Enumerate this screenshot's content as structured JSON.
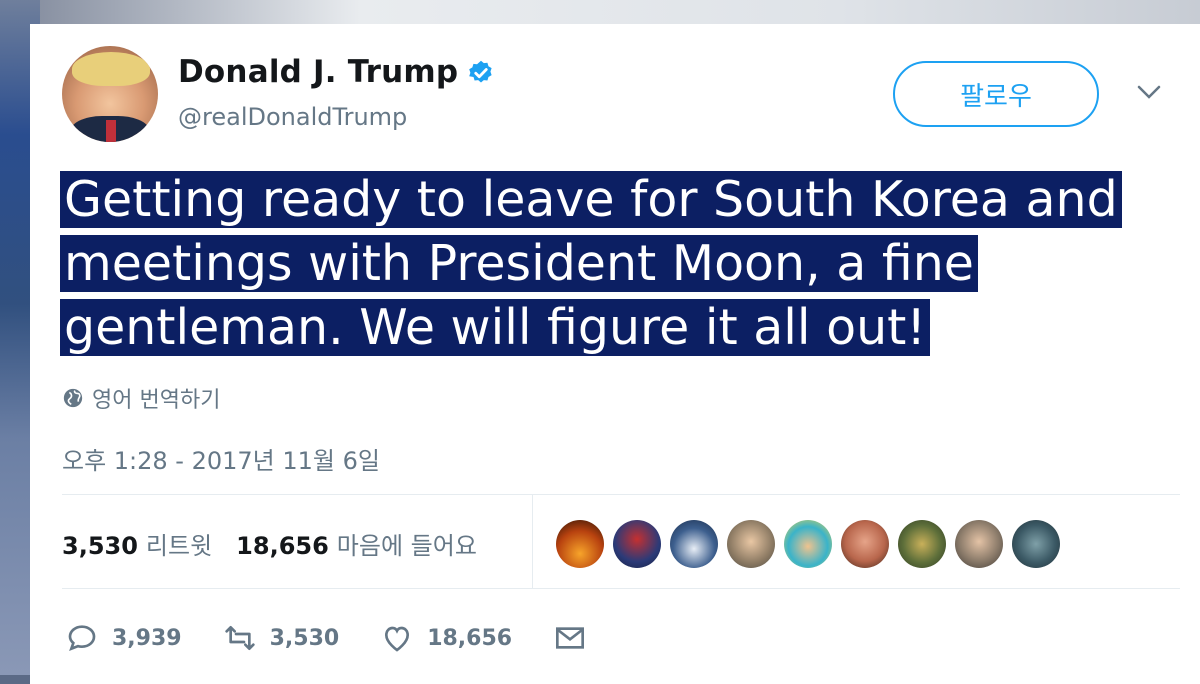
{
  "tweet": {
    "author_name": "Donald J. Trump",
    "handle": "@realDonaldTrump",
    "follow_label": "팔로우",
    "text": "Getting ready to leave for South Korea and meetings with President Moon, a fine gentleman. We will figure it all out!",
    "translate_label": "영어 번역하기",
    "timestamp": "오후 1:28 - 2017년 11월 6일",
    "retweets_count": "3,530",
    "retweets_label": "리트윗",
    "likes_count": "18,656",
    "likes_label": "마음에 들어요",
    "actions": {
      "replies": "3,939",
      "retweets": "3,530",
      "likes": "18,656"
    },
    "icons": {
      "verified": "verified-badge-icon",
      "caret": "chevron-down-icon",
      "globe": "globe-icon",
      "reply": "reply-icon",
      "retweet": "retweet-icon",
      "like": "heart-icon",
      "message": "envelope-icon"
    },
    "colors": {
      "accent": "#1da1f2",
      "highlight": "#0c1f63",
      "muted": "#657786"
    }
  }
}
